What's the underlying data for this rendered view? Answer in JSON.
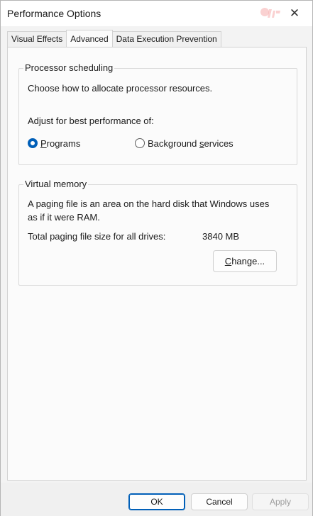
{
  "window": {
    "title": "Performance Options",
    "close_glyph": "✕"
  },
  "tabs": [
    {
      "label": "Visual Effects"
    },
    {
      "label": "Advanced"
    },
    {
      "label": "Data Execution Prevention"
    }
  ],
  "processor_scheduling": {
    "group_label": "Processor scheduling",
    "description": "Choose how to allocate processor resources.",
    "adjust_label": "Adjust for best performance of:",
    "options": [
      {
        "label_pre": "",
        "label_u": "P",
        "label_post": "rograms",
        "checked": true
      },
      {
        "label_pre": "Background ",
        "label_u": "s",
        "label_post": "ervices",
        "checked": false
      }
    ]
  },
  "virtual_memory": {
    "group_label": "Virtual memory",
    "description_line1": "A paging file is an area on the hard disk that Windows uses",
    "description_line2": "as if it were RAM.",
    "total_label": "Total paging file size for all drives:",
    "total_value": "3840 MB",
    "change_pre": "",
    "change_u": "C",
    "change_post": "hange..."
  },
  "footer": {
    "ok_label": "OK",
    "cancel_label": "Cancel",
    "apply_label": "Apply"
  },
  "colors": {
    "accent": "#005fb8"
  }
}
